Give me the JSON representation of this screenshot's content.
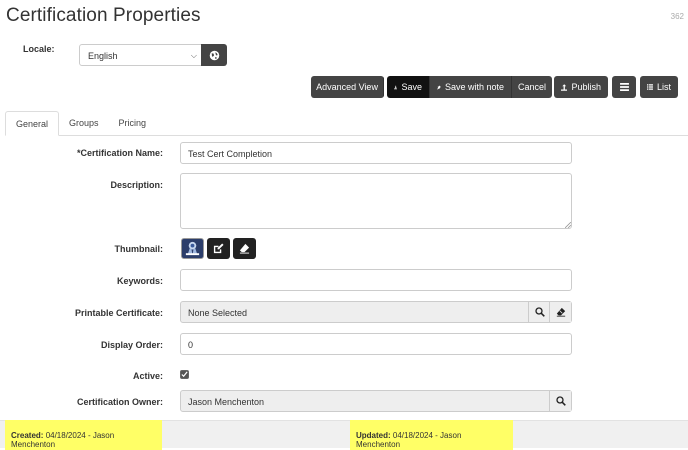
{
  "page": {
    "title": "Certification Properties",
    "record_id": "362"
  },
  "locale": {
    "label": "Locale:",
    "value": "English"
  },
  "toolbar": {
    "advanced_view": "Advanced View",
    "save": "Save",
    "save_with_note": "Save with note",
    "cancel": "Cancel",
    "publish": "Publish",
    "list": "List"
  },
  "tabs": [
    {
      "label": "General",
      "active": true
    },
    {
      "label": "Groups",
      "active": false
    },
    {
      "label": "Pricing",
      "active": false
    }
  ],
  "form": {
    "name_label": "*Certification Name:",
    "name_value": "Test Cert Completion",
    "description_label": "Description:",
    "description_value": "",
    "thumbnail_label": "Thumbnail:",
    "keywords_label": "Keywords:",
    "keywords_value": "",
    "printable_label": "Printable Certificate:",
    "printable_value": "None Selected",
    "display_order_label": "Display Order:",
    "display_order_value": "0",
    "active_label": "Active:",
    "active_checked": true,
    "owner_label": "Certification Owner:",
    "owner_value": "Jason Menchenton"
  },
  "footer": {
    "created_label": "Created:",
    "created_value": "04/18/2024 - Jason Menchenton",
    "updated_label": "Updated:",
    "updated_value": "04/18/2024 - Jason Menchenton",
    "highlight_color": "#ffff66"
  },
  "icons": {
    "locale": "globe-icon",
    "save": "download-icon",
    "save_note": "pushpin-icon",
    "publish": "upload-icon",
    "menu": "hamburger-icon",
    "list": "list-icon",
    "search": "search-icon",
    "clear": "eraser-icon"
  }
}
